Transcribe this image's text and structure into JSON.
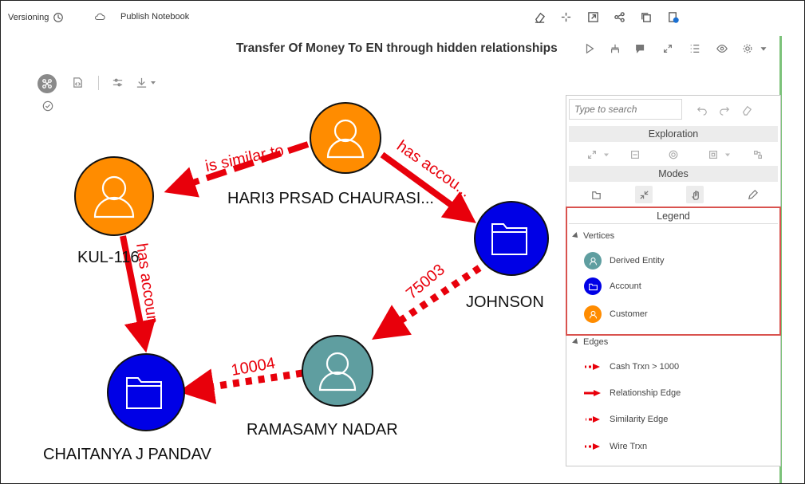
{
  "topbar": {
    "versioning": "Versioning",
    "publish": "Publish Notebook"
  },
  "title": "Transfer Of Money To EN through hidden relationships",
  "nodes": [
    {
      "id": "hari",
      "label": "HARI3 PRSAD CHAURASI...",
      "type": "customer"
    },
    {
      "id": "kul",
      "label": "KUL-116",
      "type": "customer"
    },
    {
      "id": "johnson",
      "label": "JOHNSON",
      "type": "account"
    },
    {
      "id": "ramasamy",
      "label": "RAMASAMY NADAR",
      "type": "derived"
    },
    {
      "id": "chaitanya",
      "label": "CHAITANYA J PANDAV",
      "type": "account"
    }
  ],
  "edge_labels": {
    "similar": "is similar to",
    "has_account_1": "has accou...",
    "has_account_2": "has accoun",
    "amount_1": "75003",
    "amount_2": "10004"
  },
  "panel": {
    "search_placeholder": "Type to search",
    "exploration": "Exploration",
    "modes": "Modes",
    "legend": "Legend",
    "vertices_label": "Vertices",
    "edges_label": "Edges",
    "vertices": [
      {
        "label": "Derived Entity",
        "color": "#5f9ea0"
      },
      {
        "label": "Account",
        "color": "#0000e6"
      },
      {
        "label": "Customer",
        "color": "#ff8c00"
      }
    ],
    "edges": [
      {
        "label": "Cash Trxn > 1000",
        "style": "dotted-arrow"
      },
      {
        "label": "Relationship Edge",
        "style": "solid-arrow"
      },
      {
        "label": "Similarity Edge",
        "style": "dashed-arrow"
      },
      {
        "label": "Wire Trxn",
        "style": "dotted-arrow"
      }
    ]
  },
  "colors": {
    "customer": "#ff8c00",
    "account": "#0000e6",
    "derived": "#5f9ea0",
    "edge": "#e8000b",
    "highlight": "#d9534f"
  }
}
